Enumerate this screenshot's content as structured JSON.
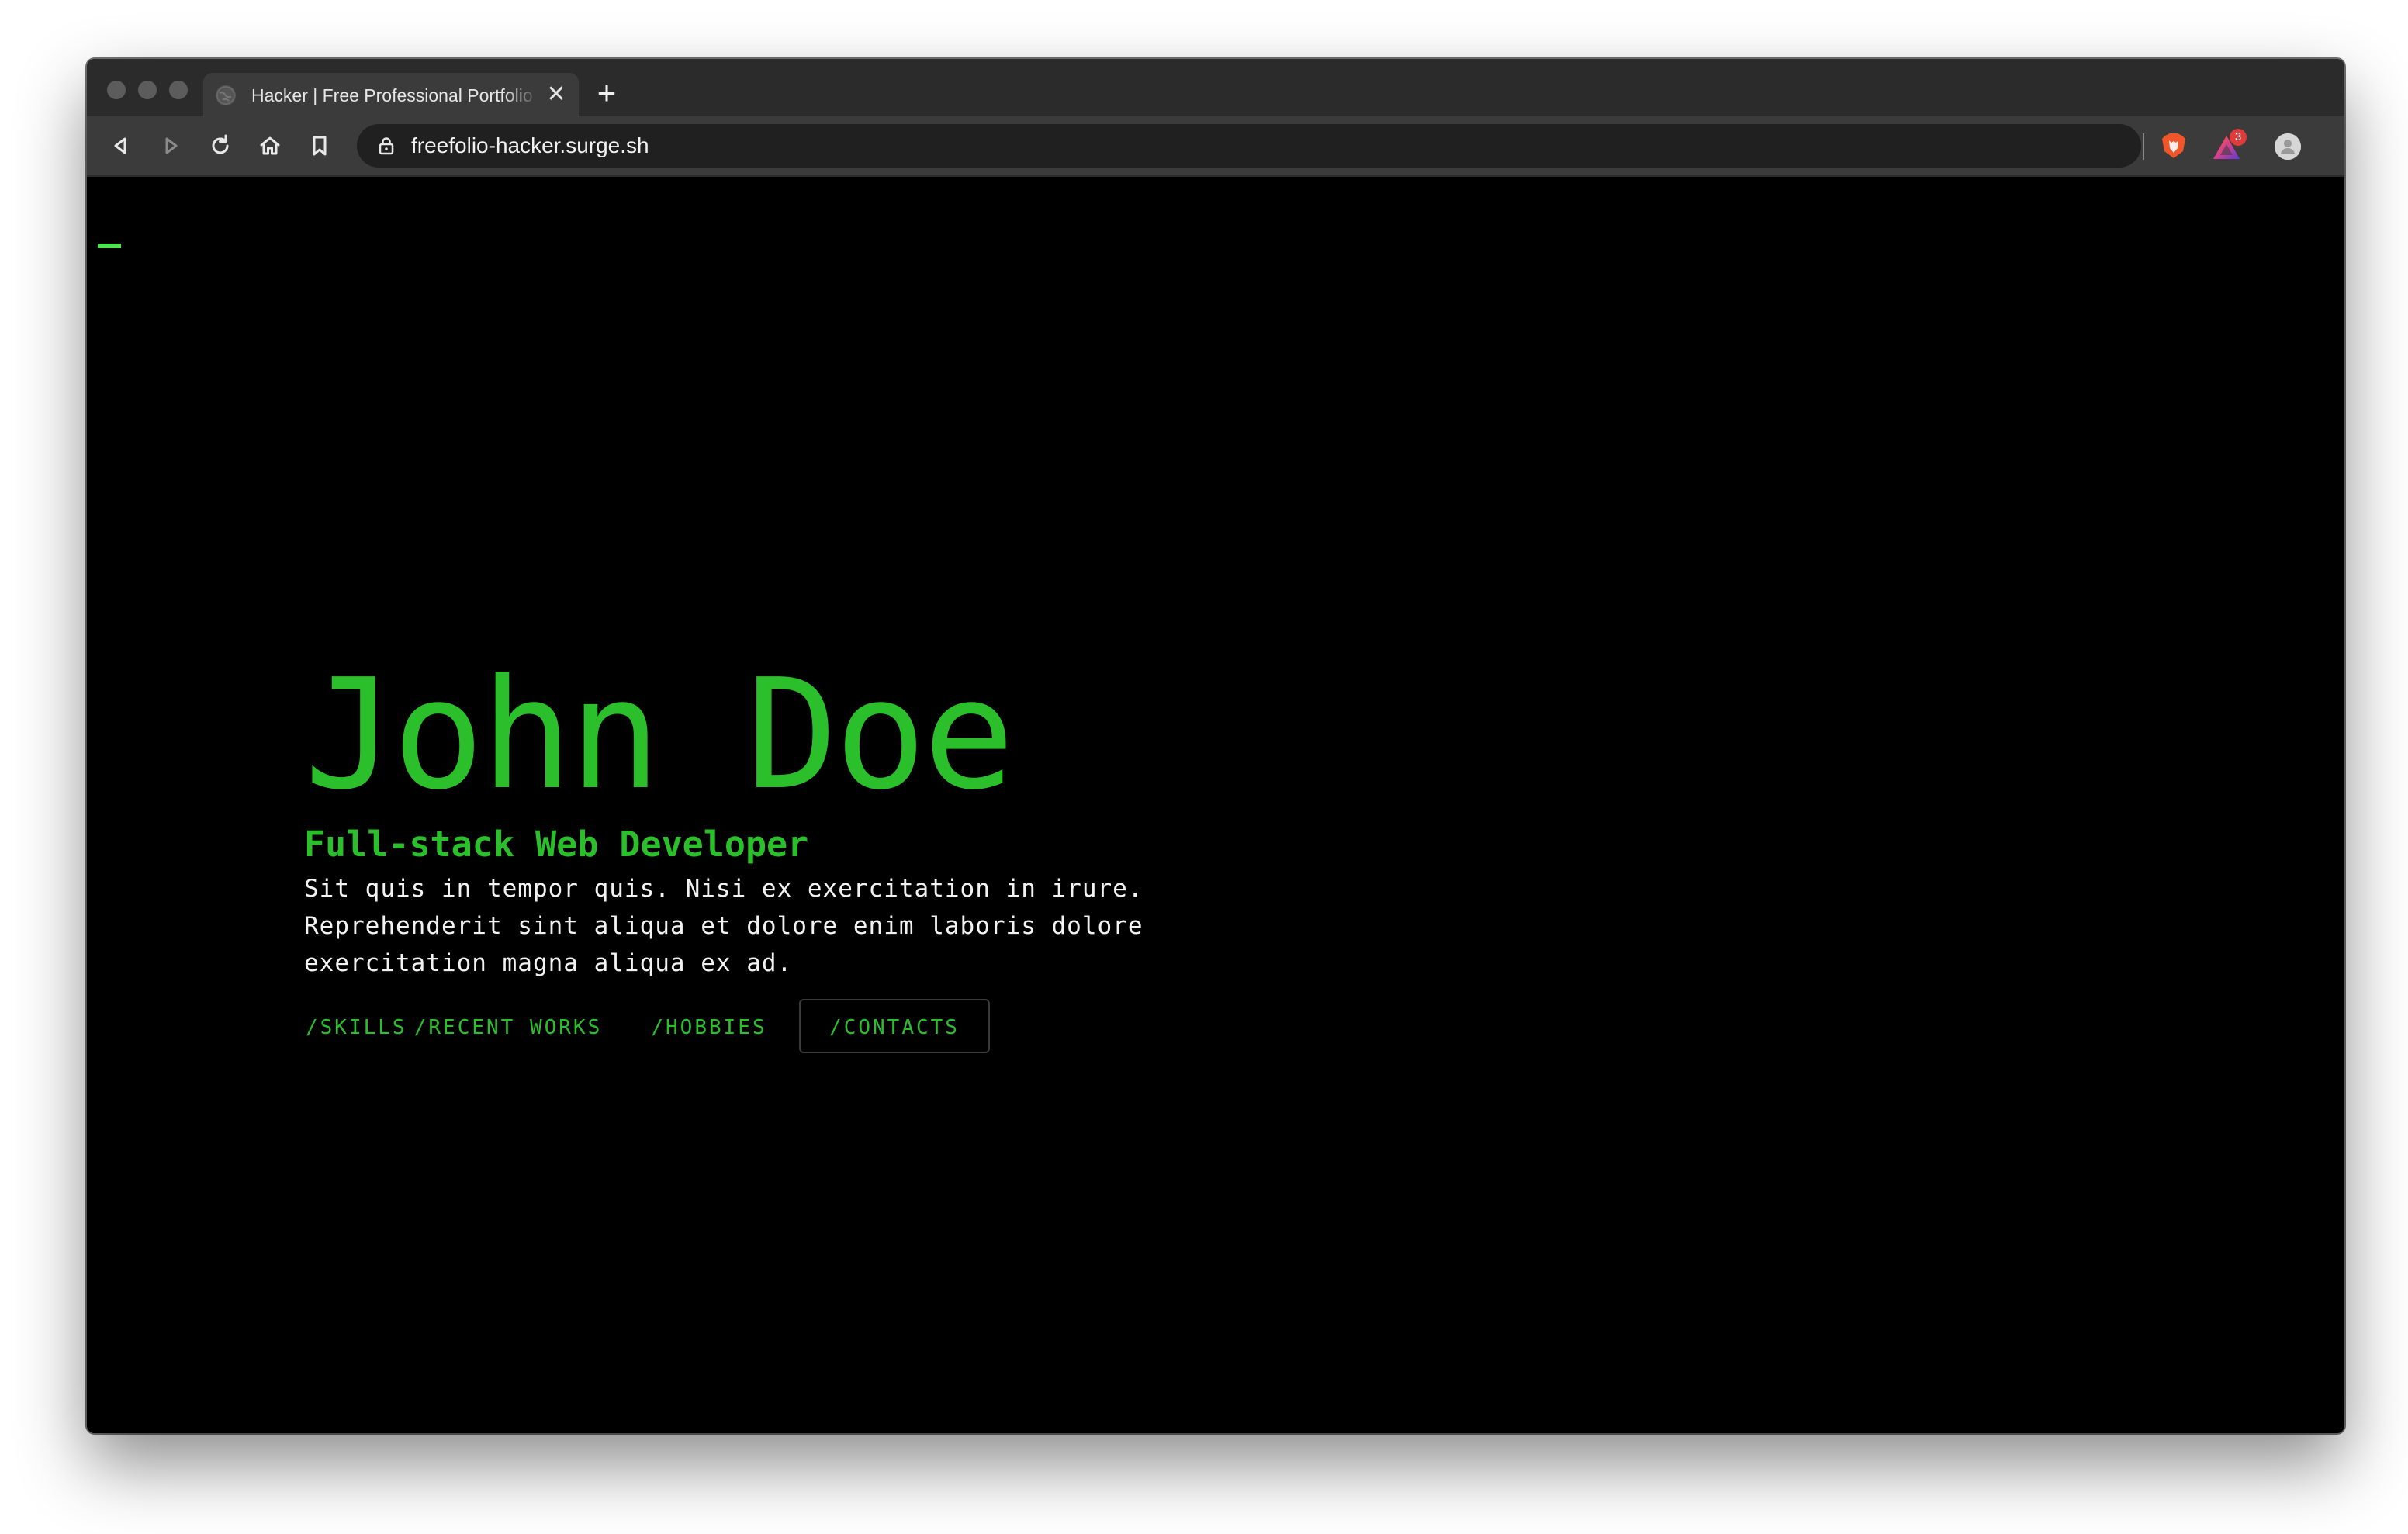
{
  "browser": {
    "tab": {
      "title": "Hacker | Free Professional Portfolio",
      "close_glyph": "✕",
      "favicon": "globe-icon"
    },
    "new_tab_glyph": "+",
    "toolbar": {
      "icons": [
        "back-icon",
        "forward-icon",
        "reload-icon",
        "home-icon",
        "bookmark-icon"
      ]
    },
    "address_bar": {
      "url": "freefolio-hacker.surge.sh",
      "icon": "lock-icon"
    },
    "extensions": {
      "brave_shields": "brave-lion-icon",
      "rewards": "brave-rewards-icon",
      "rewards_badge": "3",
      "profile": "profile-icon"
    }
  },
  "page": {
    "hero": {
      "name": "John Doe",
      "role": "Full-stack Web Developer",
      "bio": "Sit quis in tempor quis. Nisi ex exercitation in irure. Reprehenderit sint aliqua et dolore enim laboris dolore exercitation magna aliqua ex ad."
    },
    "nav": [
      {
        "label": "/SKILLS",
        "active": false
      },
      {
        "label": "/RECENT WORKS",
        "active": false
      },
      {
        "label": "/HOBBIES",
        "active": false
      },
      {
        "label": "/CONTACTS",
        "active": true
      }
    ]
  },
  "colors": {
    "accent_green": "#2bc02b",
    "cursor_green": "#4ee44e",
    "page_background": "#000000",
    "body_text": "#f2f2f2",
    "browser_chrome": "#3b3b3b"
  }
}
